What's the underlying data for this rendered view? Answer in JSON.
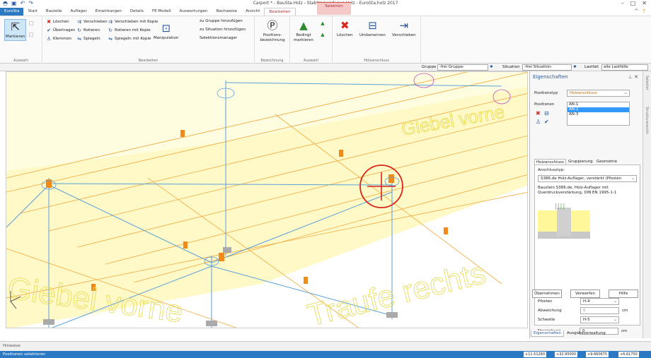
{
  "window": {
    "title": "Carport * - BauSta-Holz - Stabtragwerk aus Holz - EuroSta.holz 2017",
    "context_tab": "Selektion"
  },
  "tabs": [
    {
      "label": "EuroSta"
    },
    {
      "label": "Start"
    },
    {
      "label": "Bauteile"
    },
    {
      "label": "Auflager"
    },
    {
      "label": "Einwirkungen"
    },
    {
      "label": "Details"
    },
    {
      "label": "FE-Modell"
    },
    {
      "label": "Auswertungen"
    },
    {
      "label": "Nachweise"
    },
    {
      "label": "Ansicht"
    },
    {
      "label": "Bearbeiten"
    }
  ],
  "ribbon": {
    "auswahl": {
      "markieren": "Markieren",
      "label": "Auswahl"
    },
    "bearbeiten": {
      "loeschen": "Löschen",
      "uebertragen": "Übertragen",
      "klemmen": "Klemmen",
      "verschieben": "Verschieben",
      "rotieren": "Rotieren",
      "spiegeln": "Spiegeln",
      "verschieben_kopie": "Verschieben mit Kopie",
      "rotieren_kopie": "Rotieren mit Kopie",
      "spiegeln_kopie": "Spiegeln mit Kopie",
      "manipulation": "Manipulation",
      "zu_gruppe": "zu Gruppe hinzufügen",
      "zu_situation": "zu Situation hinzufügen",
      "selektionsmanager": "Selektionsmanager",
      "label": "Bearbeiten"
    },
    "bezeichnung": {
      "positionsbezeichnung": "Positions-bezeichnung",
      "label": "Bezeichnung"
    },
    "auswahl2": {
      "bedingt": "Bedingt markieren",
      "label": "Auswahl"
    },
    "holzanschluss": {
      "loeschen": "Löschen",
      "umbenennen": "Umbenennen",
      "verschieben": "Verschieben",
      "label": "Holzanschluss"
    }
  },
  "filter": {
    "gruppe_label": "Gruppe",
    "gruppe_value": "-frei Gruppe-",
    "situation_label": "Situation",
    "situation_value": "-frei Situation-",
    "lastfall_label": "Lastfall",
    "lastfall_value": "alle Lastfälle"
  },
  "viewport": {
    "text1": "Giebel vorne",
    "text2": "Traufe rechts",
    "text3": "Giebel vorne"
  },
  "properties": {
    "title": "Eigenschaften",
    "positionstyp_label": "Positionstyp",
    "positionstyp_value": "Holzanschluss",
    "positionen_label": "Positionen",
    "positionen": [
      "AN-1",
      "AN-2",
      "AN-3"
    ],
    "tabs": [
      "Holzanschluss",
      "Gruppierung",
      "Geometrie"
    ],
    "anschlusstyp_label": "Anschlusstyp:",
    "anschlusstyp_value": "S386.de Holz-Auflager, verstärkt (Pfosten",
    "description": "Baustein S386.de, Holz-Auflager mit Querdruckverstärkung, DIN EN 1995-1-1",
    "pfosten_label": "Pfosten",
    "pfosten_value": "H-4",
    "abweichung1_label": "Abweichung",
    "abweichung1_value": "0",
    "abweichung1_unit": "cm",
    "schwelle_label": "Schwelle",
    "schwelle_value": "H-5",
    "abweichung2_label": "Abweichung",
    "abweichung2_value": "0",
    "abweichung2_unit": "cm",
    "buttons": {
      "uebernehmen": "Übernehmen",
      "verwerfen": "Verwerfen",
      "hilfe": "Hilfe"
    },
    "bottom_tabs": [
      "Eigenschaften",
      "Ausgabeverwaltung"
    ]
  },
  "sidebar": {
    "item1": "Selektor",
    "item2": "Strukturansicht"
  },
  "hinweise": "Hinweise",
  "status": {
    "text": "Positionen selektieren",
    "x": "+11.51260",
    "y": "+32.95000",
    "z": "+9.660675",
    "w": "+6.61750"
  }
}
